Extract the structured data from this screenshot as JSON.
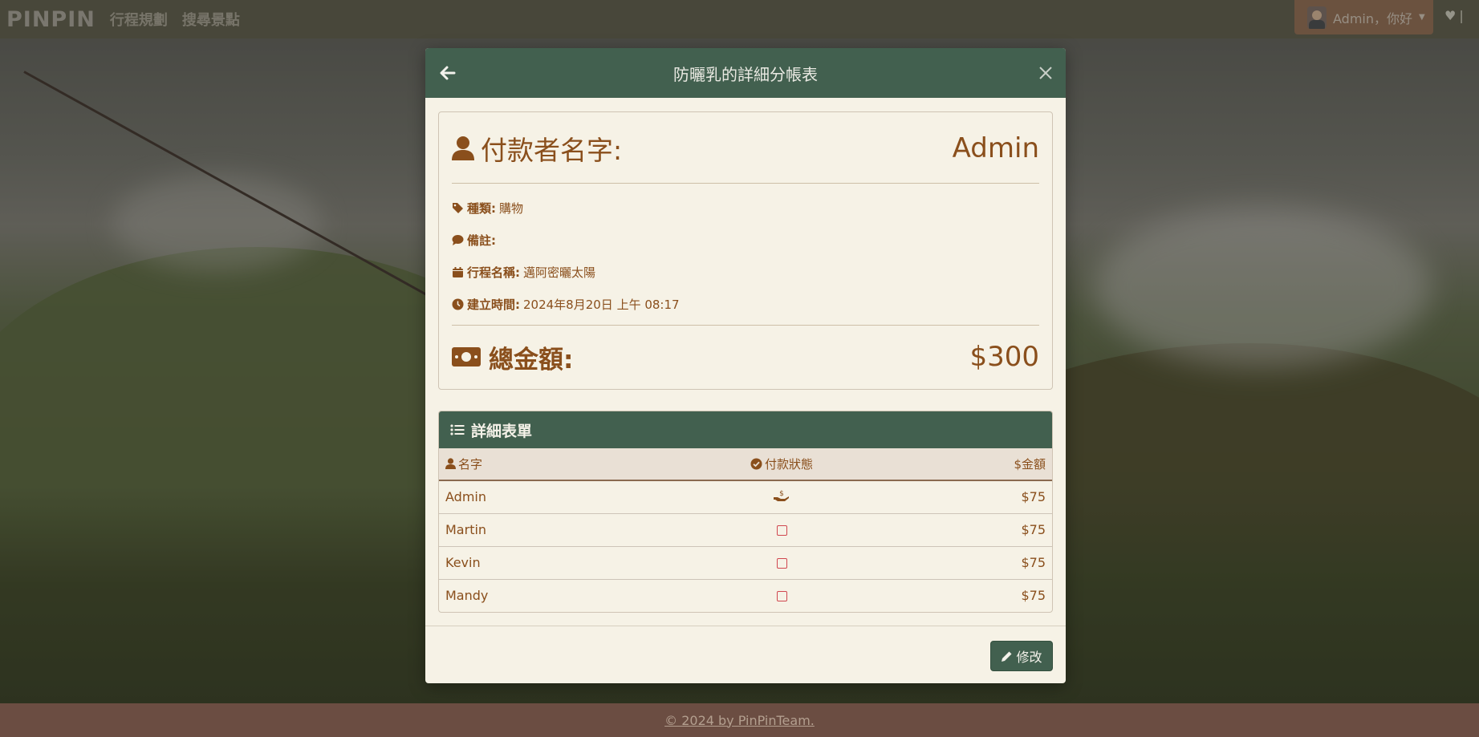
{
  "navbar": {
    "brand": "PINPIN",
    "links": [
      "行程規劃",
      "搜尋景點"
    ],
    "user_label": "Admin，你好"
  },
  "modal": {
    "title": "防曬乳的詳細分帳表",
    "payer_label": "付款者名字:",
    "payer_value": "Admin",
    "category_label": "種類:",
    "category_value": "購物",
    "note_label": "備註:",
    "note_value": "",
    "trip_label": "行程名稱:",
    "trip_value": "邁阿密曬太陽",
    "created_label": "建立時間:",
    "created_value": "2024年8月20日 上午 08:17",
    "total_label": "總金額:",
    "total_value": "$300",
    "detail_title": "詳細表單",
    "columns": [
      "名字",
      "付款狀態",
      "$金額"
    ],
    "rows": [
      {
        "name": "Admin",
        "status": "paid",
        "amount": "$75"
      },
      {
        "name": "Martin",
        "status": "unpaid",
        "amount": "$75"
      },
      {
        "name": "Kevin",
        "status": "unpaid",
        "amount": "$75"
      },
      {
        "name": "Mandy",
        "status": "unpaid",
        "amount": "$75"
      }
    ],
    "edit_label": "修改"
  },
  "footer": {
    "text": "© 2024 by PinPinTeam."
  },
  "colors": {
    "header_green": "#42604f",
    "accent_brown": "#8a4f1c",
    "unpaid_red": "#d0474f"
  }
}
